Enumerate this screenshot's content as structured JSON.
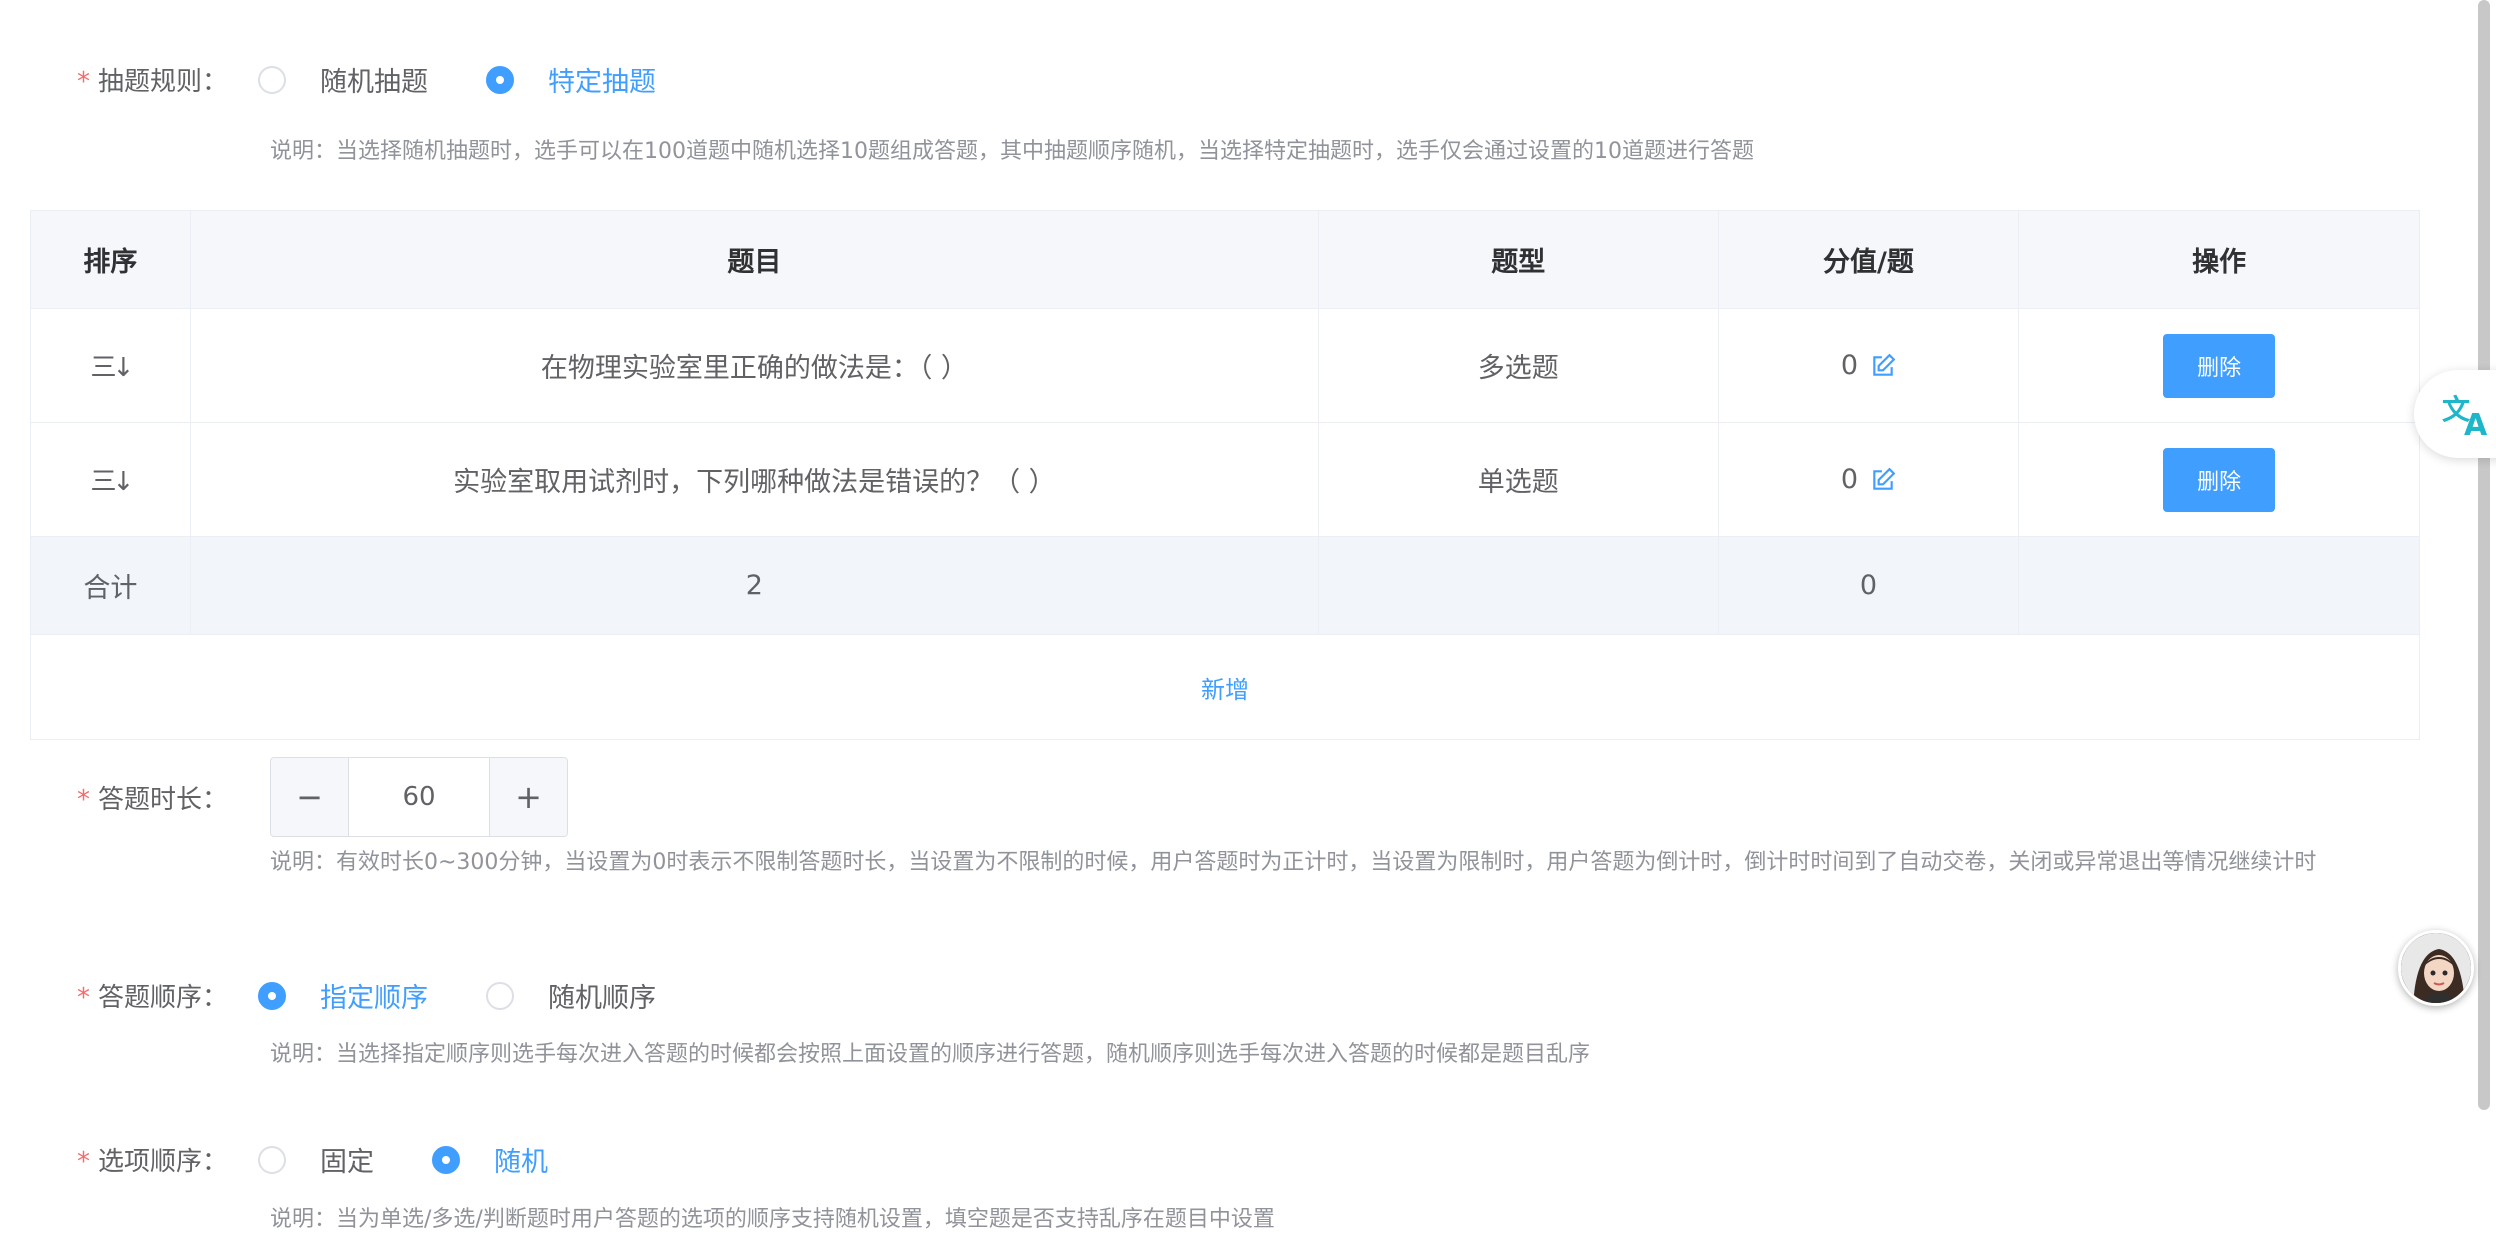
{
  "rule": {
    "label": "抽题规则：",
    "options": [
      "随机抽题",
      "特定抽题"
    ],
    "selected": "特定抽题",
    "note": "说明：当选择随机抽题时，选手可以在100道题中随机选择10题组成答题，其中抽题顺序随机，当选择特定抽题时，选手仅会通过设置的10道题进行答题"
  },
  "table": {
    "headers": [
      "排序",
      "题目",
      "题型",
      "分值/题",
      "操作"
    ],
    "rows": [
      {
        "sort": "三↓",
        "question": "在物理实验室里正确的做法是：（ ）",
        "type": "多选题",
        "score": "0",
        "action": "删除"
      },
      {
        "sort": "三↓",
        "question": "实验室取用试剂时，下列哪种做法是错误的？（ ）",
        "type": "单选题",
        "score": "0",
        "action": "删除"
      }
    ],
    "summary": {
      "label": "合计",
      "count": "2",
      "score": "0"
    },
    "add_label": "新增"
  },
  "duration": {
    "label": "答题时长：",
    "value": "60",
    "minus": "−",
    "plus": "+",
    "note": "说明：有效时长0~300分钟，当设置为0时表示不限制答题时长，当设置为不限制的时候，用户答题时为正计时，当设置为限制时，用户答题为倒计时，倒计时时间到了自动交卷，关闭或异常退出等情况继续计时"
  },
  "order": {
    "label": "答题顺序：",
    "options": [
      "指定顺序",
      "随机顺序"
    ],
    "selected": "指定顺序",
    "note": "说明：当选择指定顺序则选手每次进入答题的时候都会按照上面设置的顺序进行答题，随机顺序则选手每次进入答题的时候都是题目乱序"
  },
  "option_order": {
    "label": "选项顺序：",
    "options": [
      "固定",
      "随机"
    ],
    "selected": "随机",
    "note": "说明：当为单选/多选/判断题时用户答题的选项的顺序支持随机设置，填空题是否支持乱序在题目中设置"
  },
  "colors": {
    "primary": "#409eff",
    "required": "#f56c6c",
    "translate": "#1fb6c9"
  },
  "icons": {
    "edit": "edit-icon",
    "sort": "sort-icon",
    "translate": "translate-icon",
    "avatar": "avatar"
  }
}
